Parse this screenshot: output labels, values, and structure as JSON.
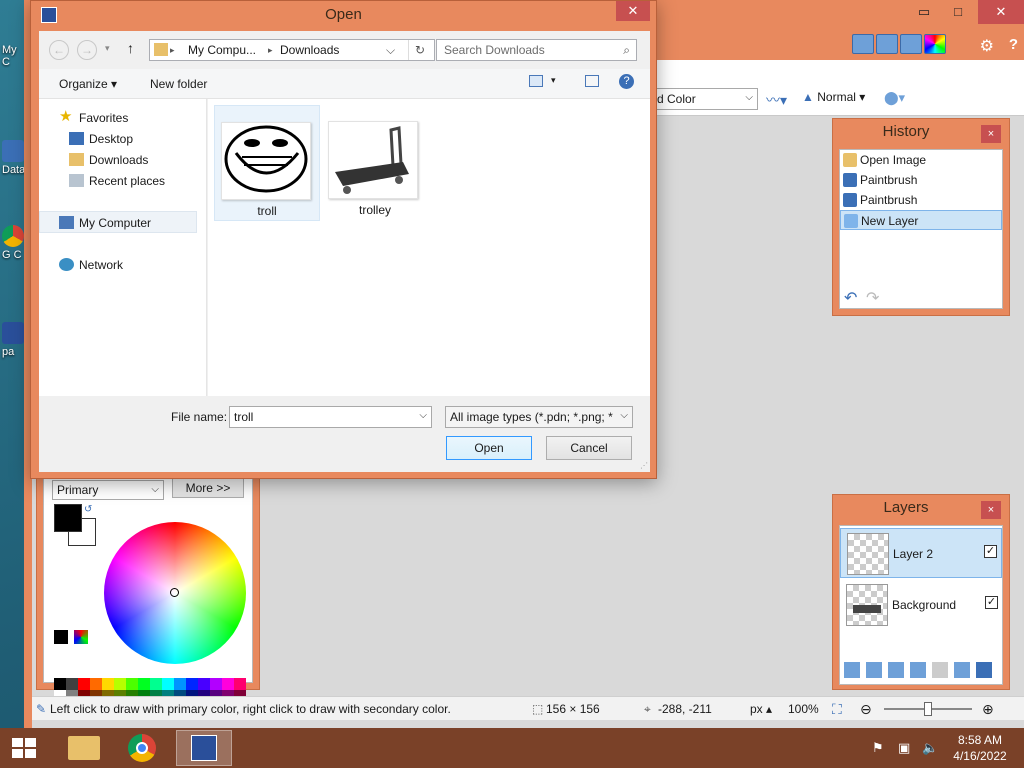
{
  "desktop": {
    "icons": [
      {
        "label": "My C"
      },
      {
        "label": "Data"
      },
      {
        "label": "G C"
      },
      {
        "label": "pa"
      }
    ]
  },
  "app": {
    "controls": {
      "minimize": "▭",
      "maximize": "□",
      "close": "✕"
    },
    "toolbar": {
      "fill_mode_value": "d Color",
      "blend_mode": "Normal"
    }
  },
  "history": {
    "title": "History",
    "close": "×",
    "items": [
      {
        "label": "Open Image",
        "icon": "folder-icon"
      },
      {
        "label": "Paintbrush",
        "icon": "paintbrush-icon"
      },
      {
        "label": "Paintbrush",
        "icon": "paintbrush-icon"
      },
      {
        "label": "New Layer",
        "icon": "new-layer-icon",
        "selected": true
      }
    ],
    "undo": "↶",
    "redo": "↷"
  },
  "layers": {
    "title": "Layers",
    "close": "×",
    "items": [
      {
        "name": "Layer 2",
        "visible": "✓",
        "selected": true
      },
      {
        "name": "Background",
        "visible": "✓"
      }
    ]
  },
  "colors": {
    "mode": "Primary",
    "more_button": "More >>",
    "palette": [
      "#000000",
      "#404040",
      "#ff0000",
      "#ff6a00",
      "#ffd800",
      "#b6ff00",
      "#4cff00",
      "#00ff21",
      "#00ff90",
      "#00ffff",
      "#0094ff",
      "#0026ff",
      "#4800ff",
      "#b200ff",
      "#ff00dc",
      "#ff006e",
      "#ffffff",
      "#808080",
      "#7f0000",
      "#7f3300",
      "#7f6a00",
      "#5b7f00",
      "#267f00",
      "#007f0e",
      "#007f46",
      "#007f7f",
      "#004a7f",
      "#00137f",
      "#21007f",
      "#57007f",
      "#7f006e",
      "#7f0037"
    ]
  },
  "status": {
    "hint": "Left click to draw with primary color, right click to draw with secondary color.",
    "selection_size": "156 × 156",
    "cursor_pos": "-288, -211",
    "units": "px",
    "zoom": "100%"
  },
  "dialog": {
    "title": "Open",
    "close": "✕",
    "nav": {
      "back": "←",
      "forward": "→",
      "up": "↑"
    },
    "address": {
      "seg1": "My Compu...",
      "sep": "▸",
      "seg2": "Downloads"
    },
    "search_placeholder": "Search Downloads",
    "organize": "Organize ▾",
    "new_folder": "New folder",
    "sidebar": {
      "favorites": "Favorites",
      "desktop": "Desktop",
      "downloads": "Downloads",
      "recent": "Recent places",
      "computer": "My Computer",
      "network": "Network"
    },
    "files": [
      {
        "name": "troll",
        "selected": true
      },
      {
        "name": "trolley"
      }
    ],
    "filename_label": "File name:",
    "filename_value": "troll",
    "filetype": "All image types (*.pdn; *.png; *",
    "open_button": "Open",
    "cancel_button": "Cancel"
  },
  "taskbar": {
    "clock_time": "8:58 AM",
    "clock_date": "4/16/2022"
  }
}
